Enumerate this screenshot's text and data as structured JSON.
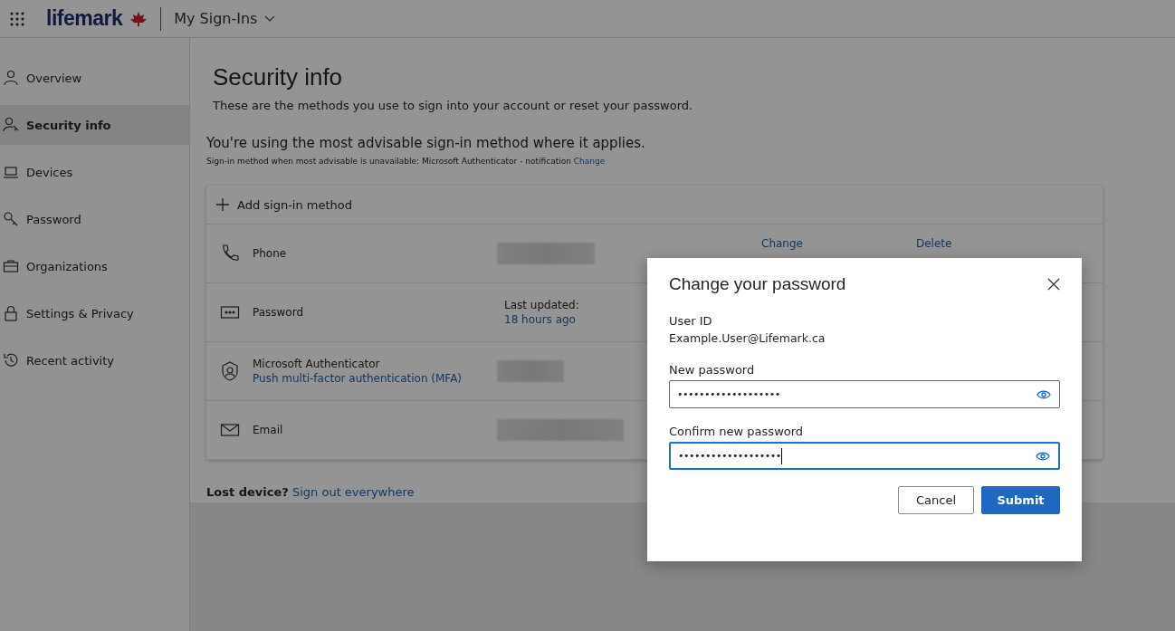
{
  "header": {
    "logo": "lifemark",
    "app_title": "My Sign-Ins"
  },
  "sidebar": {
    "items": [
      {
        "label": "Overview",
        "selected": false
      },
      {
        "label": "Security info",
        "selected": true
      },
      {
        "label": "Devices",
        "selected": false
      },
      {
        "label": "Password",
        "selected": false
      },
      {
        "label": "Organizations",
        "selected": false
      },
      {
        "label": "Settings & Privacy",
        "selected": false
      },
      {
        "label": "Recent activity",
        "selected": false
      }
    ]
  },
  "main": {
    "title": "Security info",
    "subtitle": "These are the methods you use to sign into your account or reset your password.",
    "advisory": "You're using the most advisable sign-in method where it applies.",
    "fallback_note": "Sign-in method when most advisable is unavailable: Microsoft Authenticator - notification",
    "fallback_link": "Change",
    "add_method": "Add sign-in method",
    "methods": [
      {
        "name": "Phone",
        "links": [
          "Change",
          "Delete"
        ]
      },
      {
        "name": "Password",
        "updated_label": "Last updated:",
        "updated_value": "18 hours ago"
      },
      {
        "name": "Microsoft Authenticator",
        "detail": "Push multi-factor authentication (MFA)"
      },
      {
        "name": "Email"
      }
    ],
    "lost_device": "Lost device?",
    "sign_out_link": "Sign out everywhere"
  },
  "dialog": {
    "title": "Change your password",
    "user_id_label": "User ID",
    "user_id": "Example.User@Lifemark.ca",
    "fields": [
      {
        "label": "New password",
        "value": "•••••••••••••••••••",
        "focused": false
      },
      {
        "label": "Confirm new password",
        "value": "•••••••••••••••••••",
        "focused": true
      }
    ],
    "buttons": [
      {
        "label": "Cancel",
        "kind": "secondary"
      },
      {
        "label": "Submit",
        "kind": "primary"
      }
    ]
  }
}
